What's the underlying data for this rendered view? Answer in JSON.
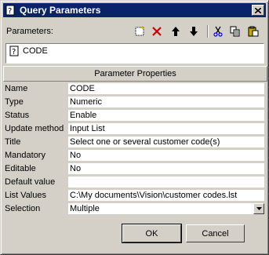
{
  "window": {
    "title": "Query Parameters"
  },
  "toolbar": {
    "label": "Parameters:",
    "icons": [
      "new-icon",
      "delete-icon",
      "move-up-icon",
      "move-down-icon",
      "cut-icon",
      "copy-icon",
      "paste-icon"
    ]
  },
  "parameters": [
    {
      "name": "CODE"
    }
  ],
  "properties": {
    "header": "Parameter Properties",
    "rows": [
      {
        "key": "Name",
        "value": "CODE"
      },
      {
        "key": "Type",
        "value": "Numeric"
      },
      {
        "key": "Status",
        "value": "Enable"
      },
      {
        "key": "Update method",
        "value": "Input List"
      },
      {
        "key": "Title",
        "value": "Select one or several customer code(s)"
      },
      {
        "key": "Mandatory",
        "value": "No"
      },
      {
        "key": "Editable",
        "value": "No"
      },
      {
        "key": "Default value",
        "value": ""
      },
      {
        "key": "List Values",
        "value": "C:\\My documents\\Vision\\customer codes.lst"
      },
      {
        "key": "Selection",
        "value": "Multiple"
      }
    ]
  },
  "buttons": {
    "ok": "OK",
    "cancel": "Cancel"
  },
  "colors": {
    "titlebar": "#0a246a",
    "face": "#d4d0c8",
    "delete": "#cc0000"
  }
}
